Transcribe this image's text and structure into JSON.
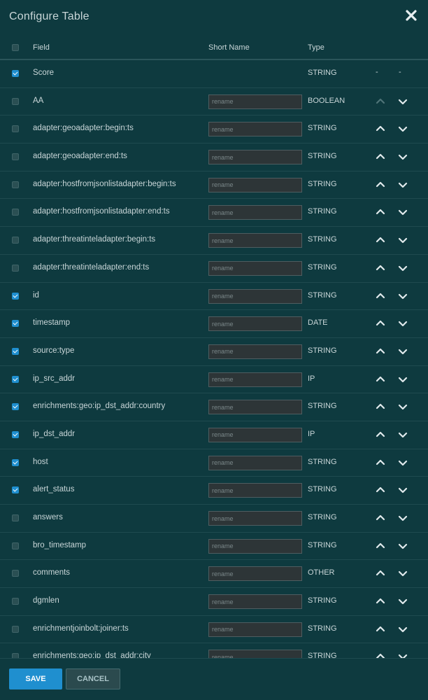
{
  "dialog": {
    "title": "Configure Table",
    "icons": {
      "close": "close-icon"
    }
  },
  "columns": {
    "field": "Field",
    "short_name": "Short Name",
    "type": "Type"
  },
  "rename_placeholder": "rename",
  "rows": [
    {
      "field": "Score",
      "type": "STRING",
      "checked": true,
      "fixed": true
    },
    {
      "field": "AA",
      "type": "BOOLEAN",
      "checked": false,
      "up_disabled": true
    },
    {
      "field": "adapter:geoadapter:begin:ts",
      "type": "STRING",
      "checked": false
    },
    {
      "field": "adapter:geoadapter:end:ts",
      "type": "STRING",
      "checked": false
    },
    {
      "field": "adapter:hostfromjsonlistadapter:begin:ts",
      "type": "STRING",
      "checked": false
    },
    {
      "field": "adapter:hostfromjsonlistadapter:end:ts",
      "type": "STRING",
      "checked": false
    },
    {
      "field": "adapter:threatinteladapter:begin:ts",
      "type": "STRING",
      "checked": false
    },
    {
      "field": "adapter:threatinteladapter:end:ts",
      "type": "STRING",
      "checked": false
    },
    {
      "field": "id",
      "type": "STRING",
      "checked": true
    },
    {
      "field": "timestamp",
      "type": "DATE",
      "checked": true
    },
    {
      "field": "source:type",
      "type": "STRING",
      "checked": true
    },
    {
      "field": "ip_src_addr",
      "type": "IP",
      "checked": true
    },
    {
      "field": "enrichments:geo:ip_dst_addr:country",
      "type": "STRING",
      "checked": true
    },
    {
      "field": "ip_dst_addr",
      "type": "IP",
      "checked": true
    },
    {
      "field": "host",
      "type": "STRING",
      "checked": true
    },
    {
      "field": "alert_status",
      "type": "STRING",
      "checked": true
    },
    {
      "field": "answers",
      "type": "STRING",
      "checked": false
    },
    {
      "field": "bro_timestamp",
      "type": "STRING",
      "checked": false
    },
    {
      "field": "comments",
      "type": "OTHER",
      "checked": false
    },
    {
      "field": "dgmlen",
      "type": "STRING",
      "checked": false
    },
    {
      "field": "enrichmentjoinbolt:joiner:ts",
      "type": "STRING",
      "checked": false
    },
    {
      "field": "enrichments:geo:ip_dst_addr:city",
      "type": "STRING",
      "checked": false
    }
  ],
  "fixed_marker": "-",
  "footer": {
    "save_label": "SAVE",
    "cancel_label": "CANCEL"
  },
  "colors": {
    "background": "#0e3a3f",
    "accent": "#1f8fcf",
    "text": "#c9d6d8"
  }
}
